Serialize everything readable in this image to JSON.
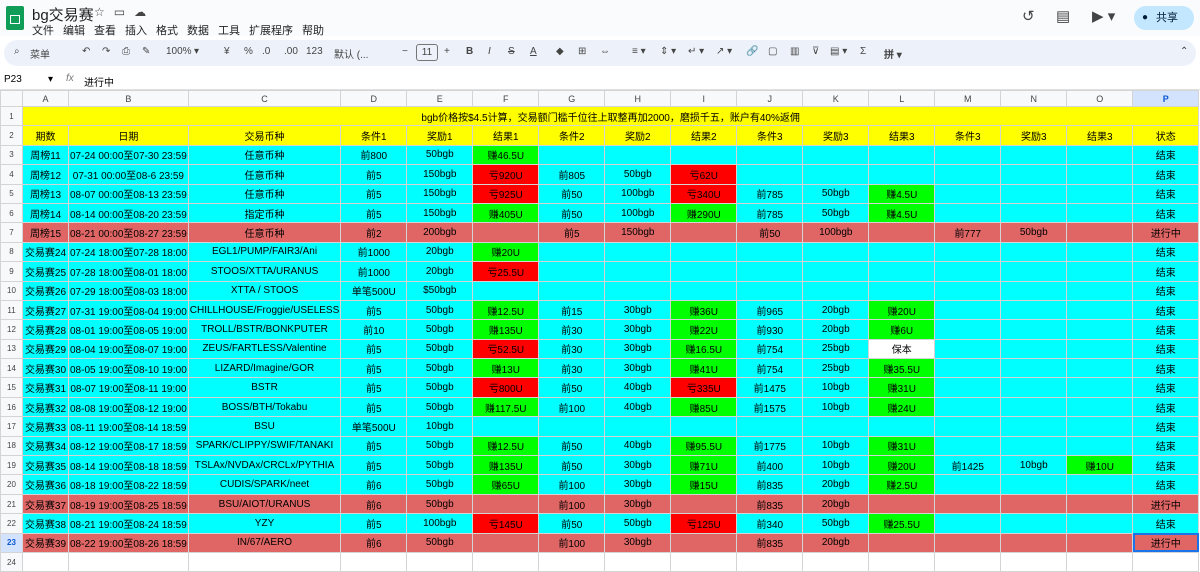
{
  "app": {
    "title": "bg交易赛",
    "menu": [
      "文件",
      "编辑",
      "查看",
      "插入",
      "格式",
      "数据",
      "工具",
      "扩展程序",
      "帮助"
    ],
    "share_label": "共享"
  },
  "toolbar": {
    "search_label": "菜单",
    "zoom": "100%",
    "currency": "¥",
    "percent": "%",
    "dec_less": ".0",
    "dec_more": ".00",
    "number_format": "123",
    "font": "默认 (...",
    "font_size": "11"
  },
  "formula_bar": {
    "cell_ref": "P23",
    "fx": "fx",
    "content": "进行中"
  },
  "columns": [
    "A",
    "B",
    "C",
    "D",
    "E",
    "F",
    "G",
    "H",
    "I",
    "J",
    "K",
    "L",
    "M",
    "N",
    "O",
    "P"
  ],
  "rows": [
    {
      "n": "1",
      "type": "y",
      "merged": "bgb价格按$4.5计算，交易额门槛千位往上取整再加2000，磨损千五，账户有40%返佣"
    },
    {
      "n": "2",
      "type": "y",
      "cells": [
        "期数",
        "日期",
        "交易币种",
        "条件1",
        "奖励1",
        "结果1",
        "条件2",
        "奖励2",
        "结果2",
        "条件3",
        "奖励3",
        "结果3",
        "条件3",
        "奖励3",
        "结果3",
        "状态"
      ]
    },
    {
      "n": "3",
      "type": "c",
      "cells": [
        "周榜11",
        "07-24 00:00至07-30 23:59",
        "任意币种",
        "前800",
        "50bgb",
        "赚46.5U",
        "",
        "",
        "",
        "",
        "",
        "",
        "",
        "",
        "",
        "结束"
      ],
      "marks": {
        "5": "g"
      }
    },
    {
      "n": "4",
      "type": "c",
      "cells": [
        "周榜12",
        "07-31 00:00至08-6 23:59",
        "任意币种",
        "前5",
        "150bgb",
        "亏920U",
        "前805",
        "50bgb",
        "亏62U",
        "",
        "",
        "",
        "",
        "",
        "",
        "结束"
      ],
      "marks": {
        "5": "d",
        "8": "d"
      }
    },
    {
      "n": "5",
      "type": "c",
      "cells": [
        "周榜13",
        "08-07 00:00至08-13 23:59",
        "任意币种",
        "前5",
        "150bgb",
        "亏925U",
        "前50",
        "100bgb",
        "亏340U",
        "前785",
        "50bgb",
        "赚4.5U",
        "",
        "",
        "",
        "结束"
      ],
      "marks": {
        "5": "d",
        "8": "d",
        "11": "g"
      }
    },
    {
      "n": "6",
      "type": "c",
      "cells": [
        "周榜14",
        "08-14 00:00至08-20 23:59",
        "指定币种",
        "前5",
        "150bgb",
        "赚405U",
        "前50",
        "100bgb",
        "赚290U",
        "前785",
        "50bgb",
        "赚4.5U",
        "",
        "",
        "",
        "结束"
      ],
      "marks": {
        "5": "g",
        "8": "g",
        "11": "g"
      }
    },
    {
      "n": "7",
      "type": "r",
      "cells": [
        "周榜15",
        "08-21 00:00至08-27 23:59",
        "任意币种",
        "前2",
        "200bgb",
        "",
        "前5",
        "150bgb",
        "",
        "前50",
        "100bgb",
        "",
        "前777",
        "50bgb",
        "",
        "进行中"
      ]
    },
    {
      "n": "8",
      "type": "c",
      "cells": [
        "交易赛24",
        "07-24 18:00至07-28 18:00",
        "EGL1/PUMP/FAIR3/Ani",
        "前1000",
        "20bgb",
        "赚20U",
        "",
        "",
        "",
        "",
        "",
        "",
        "",
        "",
        "",
        "结束"
      ],
      "marks": {
        "5": "g"
      }
    },
    {
      "n": "9",
      "type": "c",
      "cells": [
        "交易赛25",
        "07-28 18:00至08-01 18:00",
        "STOOS/XTTA/URANUS",
        "前1000",
        "20bgb",
        "亏25.5U",
        "",
        "",
        "",
        "",
        "",
        "",
        "",
        "",
        "",
        "结束"
      ],
      "marks": {
        "5": "d"
      }
    },
    {
      "n": "10",
      "type": "c",
      "cells": [
        "交易赛26",
        "07-29 18:00至08-03 18:00",
        "XTTA / STOOS",
        "单笔500U",
        "$50bgb",
        "",
        "",
        "",
        "",
        "",
        "",
        "",
        "",
        "",
        "",
        "结束"
      ]
    },
    {
      "n": "11",
      "type": "c",
      "cells": [
        "交易赛27",
        "07-31 19:00至08-04 19:00",
        "CHILLHOUSE/Froggie/USELESS",
        "前5",
        "50bgb",
        "赚12.5U",
        "前15",
        "30bgb",
        "赚36U",
        "前965",
        "20bgb",
        "赚20U",
        "",
        "",
        "",
        "结束"
      ],
      "marks": {
        "5": "g",
        "8": "g",
        "11": "g"
      }
    },
    {
      "n": "12",
      "type": "c",
      "cells": [
        "交易赛28",
        "08-01 19:00至08-05 19:00",
        "TROLL/BSTR/BONKPUTER",
        "前10",
        "50bgb",
        "赚135U",
        "前30",
        "30bgb",
        "赚22U",
        "前930",
        "20bgb",
        "赚6U",
        "",
        "",
        "",
        "结束"
      ],
      "marks": {
        "5": "g",
        "8": "g",
        "11": "g"
      }
    },
    {
      "n": "13",
      "type": "c",
      "cells": [
        "交易赛29",
        "08-04 19:00至08-07 19:00",
        "ZEUS/FARTLESS/Valentine",
        "前5",
        "50bgb",
        "亏52.5U",
        "前30",
        "30bgb",
        "赚16.5U",
        "前754",
        "25bgb",
        "保本",
        "",
        "",
        "",
        "结束"
      ],
      "marks": {
        "5": "d",
        "8": "g",
        "11": "wt"
      }
    },
    {
      "n": "14",
      "type": "c",
      "cells": [
        "交易赛30",
        "08-05 19:00至08-10 19:00",
        "LIZARD/Imagine/GOR",
        "前5",
        "50bgb",
        "赚13U",
        "前30",
        "30bgb",
        "赚41U",
        "前754",
        "25bgb",
        "赚35.5U",
        "",
        "",
        "",
        "结束"
      ],
      "marks": {
        "5": "g",
        "8": "g",
        "11": "g"
      }
    },
    {
      "n": "15",
      "type": "c",
      "cells": [
        "交易赛31",
        "08-07 19:00至08-11 19:00",
        "BSTR",
        "前5",
        "50bgb",
        "亏800U",
        "前50",
        "40bgb",
        "亏335U",
        "前1475",
        "10bgb",
        "赚31U",
        "",
        "",
        "",
        "结束"
      ],
      "marks": {
        "5": "d",
        "8": "d",
        "11": "g"
      }
    },
    {
      "n": "16",
      "type": "c",
      "cells": [
        "交易赛32",
        "08-08 19:00至08-12 19:00",
        "BOSS/BTH/Tokabu",
        "前5",
        "50bgb",
        "赚117.5U",
        "前100",
        "40bgb",
        "赚85U",
        "前1575",
        "10bgb",
        "赚24U",
        "",
        "",
        "",
        "结束"
      ],
      "marks": {
        "5": "g",
        "8": "g",
        "11": "g"
      }
    },
    {
      "n": "17",
      "type": "c",
      "cells": [
        "交易赛33",
        "08-11 19:00至08-14 18:59",
        "BSU",
        "单笔500U",
        "10bgb",
        "",
        "",
        "",
        "",
        "",
        "",
        "",
        "",
        "",
        "",
        "结束"
      ]
    },
    {
      "n": "18",
      "type": "c",
      "cells": [
        "交易赛34",
        "08-12 19:00至08-17 18:59",
        "SPARK/CLIPPY/SWIF/TANAKI",
        "前5",
        "50bgb",
        "赚12.5U",
        "前50",
        "40bgb",
        "赚95.5U",
        "前1775",
        "10bgb",
        "赚31U",
        "",
        "",
        "",
        "结束"
      ],
      "marks": {
        "5": "g",
        "8": "g",
        "11": "g"
      }
    },
    {
      "n": "19",
      "type": "c",
      "cells": [
        "交易赛35",
        "08-14 19:00至08-18 18:59",
        "TSLAx/NVDAx/CRCLx/PYTHIA",
        "前5",
        "50bgb",
        "赚135U",
        "前50",
        "30bgb",
        "赚71U",
        "前400",
        "10bgb",
        "赚20U",
        "前1425",
        "10bgb",
        "赚10U",
        "结束"
      ],
      "marks": {
        "5": "g",
        "8": "g",
        "11": "g",
        "14": "g"
      }
    },
    {
      "n": "20",
      "type": "c",
      "cells": [
        "交易赛36",
        "08-18 19:00至08-22 18:59",
        "CUDIS/SPARK/neet",
        "前6",
        "50bgb",
        "赚65U",
        "前100",
        "30bgb",
        "赚15U",
        "前835",
        "20bgb",
        "赚2.5U",
        "",
        "",
        "",
        "结束"
      ],
      "marks": {
        "5": "g",
        "8": "g",
        "11": "g"
      }
    },
    {
      "n": "21",
      "type": "r",
      "cells": [
        "交易赛37",
        "08-19 19:00至08-25 18:59",
        "BSU/AIOT/URANUS",
        "前6",
        "50bgb",
        "",
        "前100",
        "30bgb",
        "",
        "前835",
        "20bgb",
        "",
        "",
        "",
        "",
        "进行中"
      ]
    },
    {
      "n": "22",
      "type": "c",
      "cells": [
        "交易赛38",
        "08-21 19:00至08-24 18:59",
        "YZY",
        "前5",
        "100bgb",
        "亏145U",
        "前50",
        "50bgb",
        "亏125U",
        "前340",
        "50bgb",
        "赚25.5U",
        "",
        "",
        "",
        "结束"
      ],
      "marks": {
        "5": "d",
        "8": "d",
        "11": "g"
      }
    },
    {
      "n": "23",
      "type": "r",
      "cells": [
        "交易赛39",
        "08-22 19:00至08-26 18:59",
        "IN/67/AERO",
        "前6",
        "50bgb",
        "",
        "前100",
        "30bgb",
        "",
        "前835",
        "20bgb",
        "",
        "",
        "",
        "",
        "进行中"
      ]
    },
    {
      "n": "24",
      "type": "w",
      "cells": [
        "",
        "",
        "",
        "",
        "",
        "",
        "",
        "",
        "",
        "",
        "",
        "",
        "",
        "",
        "",
        ""
      ]
    }
  ]
}
